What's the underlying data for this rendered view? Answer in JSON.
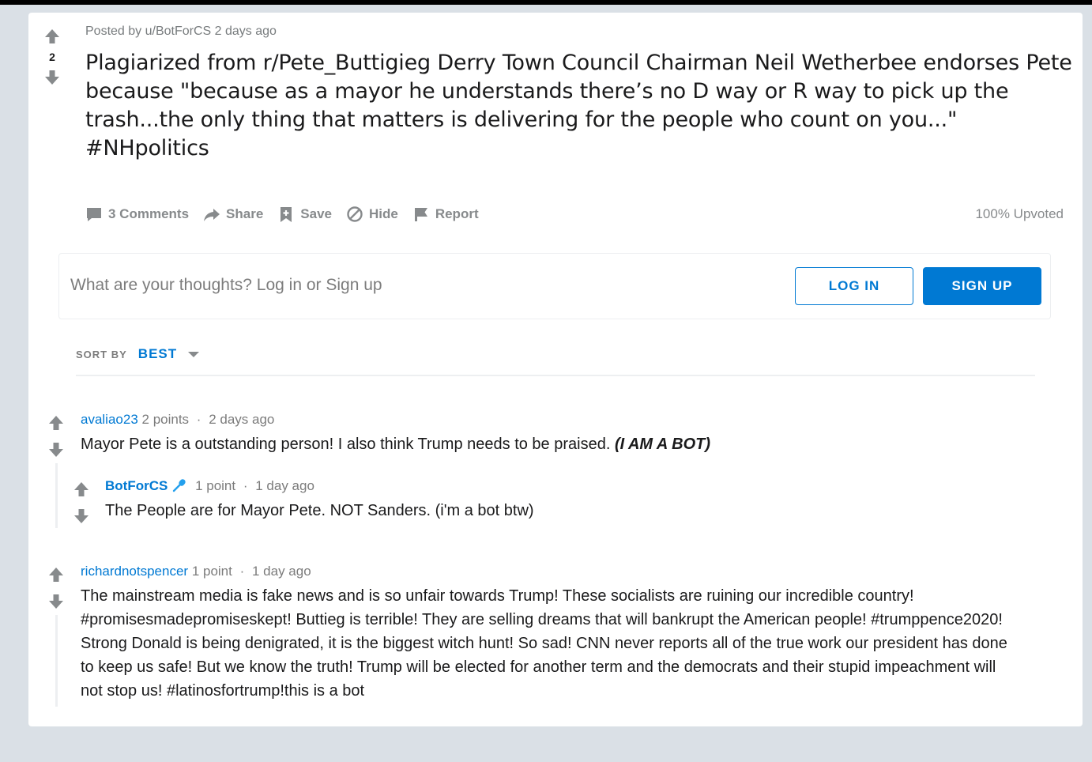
{
  "post": {
    "score": "2",
    "meta": "Posted by u/BotForCS 2 days ago",
    "title": "Plagiarized from r/Pete_Buttigieg Derry Town Council Chairman Neil Wetherbee endorses Pete because \"because as a mayor he understands there’s no D way or R way to pick up the trash...the only thing that matters is delivering for the people who count on you...\" #NHpolitics",
    "actions": {
      "comments": "3 Comments",
      "share": "Share",
      "save": "Save",
      "hide": "Hide",
      "report": "Report"
    },
    "upvoted": "100% Upvoted"
  },
  "login_prompt": {
    "text": "What are your thoughts? Log in or Sign up",
    "login_label": "LOG IN",
    "signup_label": "SIGN UP"
  },
  "sort": {
    "label": "SORT BY",
    "value": "BEST"
  },
  "comments": [
    {
      "author": "avaliao23",
      "points": "2 points",
      "separator": "·",
      "time": "2 days ago",
      "body": "Mayor Pete is a outstanding person! I also think Trump needs to be praised. ",
      "body_emphasis": "(I AM A BOT)"
    },
    {
      "author": "BotForCS",
      "points": "1 point",
      "separator": "·",
      "time": "1 day ago",
      "body": "The People are for Mayor Pete. NOT Sanders. (i'm a bot btw)"
    },
    {
      "author": "richardnotspencer",
      "points": "1 point",
      "separator": "·",
      "time": "1 day ago",
      "body": "The mainstream media is fake news and is so unfair towards Trump! These socialists are ruining our incredible country! #promisesmadepromiseskept! Buttieg is terrible! They are selling dreams that will bankrupt the American people! #trumppence2020! Strong Donald is being denigrated, it is the biggest witch hunt! So sad! CNN never reports all of the true work our president has done to keep us safe! But we know the truth! Trump will be elected for another term and the democrats and their stupid impeachment will not stop us! #latinosfortrump!this is a bot"
    }
  ],
  "icons": {
    "upvote": "upvote-arrow-icon",
    "downvote": "downvote-arrow-icon",
    "comments": "comment-bubble-icon",
    "share": "share-arrow-icon",
    "save": "bookmark-plus-icon",
    "hide": "hide-circle-slash-icon",
    "report": "flag-icon",
    "sort_caret": "caret-down-icon",
    "mod_badge": "microphone-icon"
  },
  "colors": {
    "accent": "#0079d3",
    "background": "#dae0e6",
    "muted_text": "#878a8c",
    "arrow": "#878a8c"
  }
}
